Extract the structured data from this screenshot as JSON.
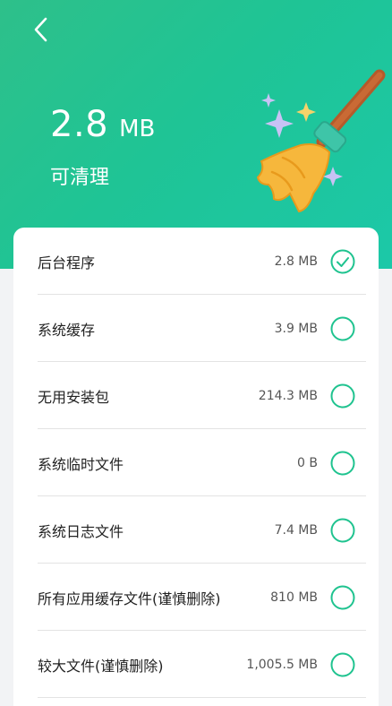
{
  "header": {
    "size_value": "2.8",
    "size_unit": "MB",
    "subtitle": "可清理"
  },
  "colors": {
    "accent": "#1fc38f",
    "header_gradient_start": "#2ec08a",
    "header_gradient_end": "#1cc8a8"
  },
  "items": [
    {
      "label": "后台程序",
      "value": "2.8 MB",
      "checked": true
    },
    {
      "label": "系统缓存",
      "value": "3.9 MB",
      "checked": false
    },
    {
      "label": "无用安装包",
      "value": "214.3 MB",
      "checked": false
    },
    {
      "label": "系统临时文件",
      "value": "0 B",
      "checked": false
    },
    {
      "label": "系统日志文件",
      "value": "7.4 MB",
      "checked": false
    },
    {
      "label": "所有应用缓存文件(谨慎删除)",
      "value": "810 MB",
      "checked": false
    },
    {
      "label": "较大文件(谨慎删除)",
      "value": "1,005.5 MB",
      "checked": false
    }
  ]
}
